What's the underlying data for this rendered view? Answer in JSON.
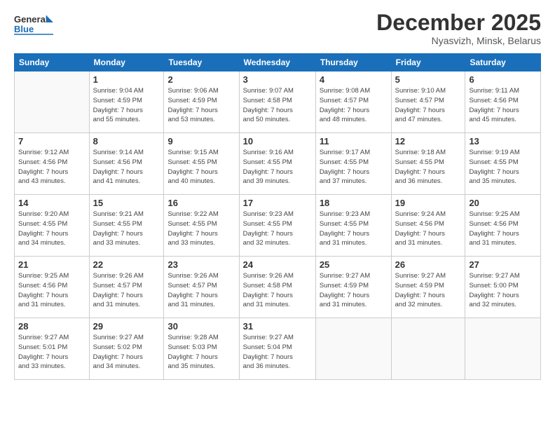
{
  "logo": {
    "general": "General",
    "blue": "Blue"
  },
  "header": {
    "month": "December 2025",
    "location": "Nyasvizh, Minsk, Belarus"
  },
  "weekdays": [
    "Sunday",
    "Monday",
    "Tuesday",
    "Wednesday",
    "Thursday",
    "Friday",
    "Saturday"
  ],
  "weeks": [
    [
      {
        "day": "",
        "info": ""
      },
      {
        "day": "1",
        "info": "Sunrise: 9:04 AM\nSunset: 4:59 PM\nDaylight: 7 hours\nand 55 minutes."
      },
      {
        "day": "2",
        "info": "Sunrise: 9:06 AM\nSunset: 4:59 PM\nDaylight: 7 hours\nand 53 minutes."
      },
      {
        "day": "3",
        "info": "Sunrise: 9:07 AM\nSunset: 4:58 PM\nDaylight: 7 hours\nand 50 minutes."
      },
      {
        "day": "4",
        "info": "Sunrise: 9:08 AM\nSunset: 4:57 PM\nDaylight: 7 hours\nand 48 minutes."
      },
      {
        "day": "5",
        "info": "Sunrise: 9:10 AM\nSunset: 4:57 PM\nDaylight: 7 hours\nand 47 minutes."
      },
      {
        "day": "6",
        "info": "Sunrise: 9:11 AM\nSunset: 4:56 PM\nDaylight: 7 hours\nand 45 minutes."
      }
    ],
    [
      {
        "day": "7",
        "info": "Sunrise: 9:12 AM\nSunset: 4:56 PM\nDaylight: 7 hours\nand 43 minutes."
      },
      {
        "day": "8",
        "info": "Sunrise: 9:14 AM\nSunset: 4:56 PM\nDaylight: 7 hours\nand 41 minutes."
      },
      {
        "day": "9",
        "info": "Sunrise: 9:15 AM\nSunset: 4:55 PM\nDaylight: 7 hours\nand 40 minutes."
      },
      {
        "day": "10",
        "info": "Sunrise: 9:16 AM\nSunset: 4:55 PM\nDaylight: 7 hours\nand 39 minutes."
      },
      {
        "day": "11",
        "info": "Sunrise: 9:17 AM\nSunset: 4:55 PM\nDaylight: 7 hours\nand 37 minutes."
      },
      {
        "day": "12",
        "info": "Sunrise: 9:18 AM\nSunset: 4:55 PM\nDaylight: 7 hours\nand 36 minutes."
      },
      {
        "day": "13",
        "info": "Sunrise: 9:19 AM\nSunset: 4:55 PM\nDaylight: 7 hours\nand 35 minutes."
      }
    ],
    [
      {
        "day": "14",
        "info": "Sunrise: 9:20 AM\nSunset: 4:55 PM\nDaylight: 7 hours\nand 34 minutes."
      },
      {
        "day": "15",
        "info": "Sunrise: 9:21 AM\nSunset: 4:55 PM\nDaylight: 7 hours\nand 33 minutes."
      },
      {
        "day": "16",
        "info": "Sunrise: 9:22 AM\nSunset: 4:55 PM\nDaylight: 7 hours\nand 33 minutes."
      },
      {
        "day": "17",
        "info": "Sunrise: 9:23 AM\nSunset: 4:55 PM\nDaylight: 7 hours\nand 32 minutes."
      },
      {
        "day": "18",
        "info": "Sunrise: 9:23 AM\nSunset: 4:55 PM\nDaylight: 7 hours\nand 31 minutes."
      },
      {
        "day": "19",
        "info": "Sunrise: 9:24 AM\nSunset: 4:56 PM\nDaylight: 7 hours\nand 31 minutes."
      },
      {
        "day": "20",
        "info": "Sunrise: 9:25 AM\nSunset: 4:56 PM\nDaylight: 7 hours\nand 31 minutes."
      }
    ],
    [
      {
        "day": "21",
        "info": "Sunrise: 9:25 AM\nSunset: 4:56 PM\nDaylight: 7 hours\nand 31 minutes."
      },
      {
        "day": "22",
        "info": "Sunrise: 9:26 AM\nSunset: 4:57 PM\nDaylight: 7 hours\nand 31 minutes."
      },
      {
        "day": "23",
        "info": "Sunrise: 9:26 AM\nSunset: 4:57 PM\nDaylight: 7 hours\nand 31 minutes."
      },
      {
        "day": "24",
        "info": "Sunrise: 9:26 AM\nSunset: 4:58 PM\nDaylight: 7 hours\nand 31 minutes."
      },
      {
        "day": "25",
        "info": "Sunrise: 9:27 AM\nSunset: 4:59 PM\nDaylight: 7 hours\nand 31 minutes."
      },
      {
        "day": "26",
        "info": "Sunrise: 9:27 AM\nSunset: 4:59 PM\nDaylight: 7 hours\nand 32 minutes."
      },
      {
        "day": "27",
        "info": "Sunrise: 9:27 AM\nSunset: 5:00 PM\nDaylight: 7 hours\nand 32 minutes."
      }
    ],
    [
      {
        "day": "28",
        "info": "Sunrise: 9:27 AM\nSunset: 5:01 PM\nDaylight: 7 hours\nand 33 minutes."
      },
      {
        "day": "29",
        "info": "Sunrise: 9:27 AM\nSunset: 5:02 PM\nDaylight: 7 hours\nand 34 minutes."
      },
      {
        "day": "30",
        "info": "Sunrise: 9:28 AM\nSunset: 5:03 PM\nDaylight: 7 hours\nand 35 minutes."
      },
      {
        "day": "31",
        "info": "Sunrise: 9:27 AM\nSunset: 5:04 PM\nDaylight: 7 hours\nand 36 minutes."
      },
      {
        "day": "",
        "info": ""
      },
      {
        "day": "",
        "info": ""
      },
      {
        "day": "",
        "info": ""
      }
    ]
  ]
}
